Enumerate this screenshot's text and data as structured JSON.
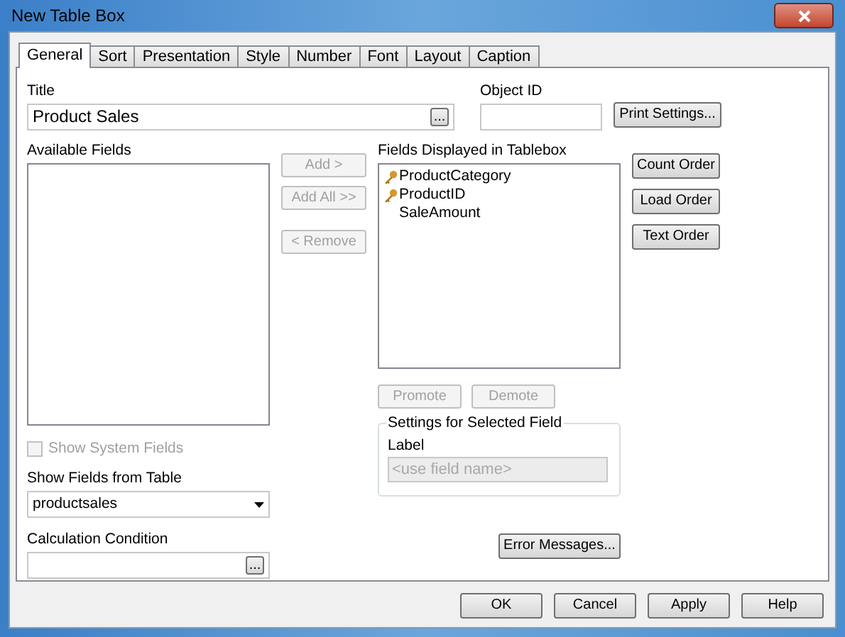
{
  "window": {
    "title": "New Table Box"
  },
  "tabs": [
    {
      "label": "General",
      "selected": true
    },
    {
      "label": "Sort",
      "selected": false
    },
    {
      "label": "Presentation",
      "selected": false
    },
    {
      "label": "Style",
      "selected": false
    },
    {
      "label": "Number",
      "selected": false
    },
    {
      "label": "Font",
      "selected": false
    },
    {
      "label": "Layout",
      "selected": false
    },
    {
      "label": "Caption",
      "selected": false
    }
  ],
  "title": {
    "label": "Title",
    "value": "Product Sales",
    "browse": "..."
  },
  "object_id": {
    "label": "Object ID"
  },
  "print_settings": "Print Settings...",
  "available_fields": {
    "label": "Available Fields"
  },
  "move_buttons": [
    {
      "label": "Add >",
      "disabled": true
    },
    {
      "label": "Add All >>",
      "disabled": true
    },
    {
      "label": "< Remove",
      "disabled": true
    }
  ],
  "displayed_fields": {
    "label": "Fields Displayed in Tablebox",
    "items": [
      {
        "name": "ProductCategory",
        "key": true
      },
      {
        "name": "ProductID",
        "key": true
      },
      {
        "name": "SaleAmount",
        "key": false
      }
    ]
  },
  "order_buttons": [
    "Count Order",
    "Load Order",
    "Text Order"
  ],
  "promote_buttons": [
    {
      "label": "Promote",
      "disabled": true
    },
    {
      "label": "Demote",
      "disabled": true
    }
  ],
  "show_system_fields": {
    "label": "Show System Fields",
    "checked": false,
    "disabled": true
  },
  "show_fields_from_table": {
    "label": "Show Fields from Table",
    "value": "productsales"
  },
  "settings_group": {
    "title": "Settings for Selected Field",
    "label": "Label",
    "placeholder": "<use field name>",
    "disabled": true
  },
  "calculation_condition": {
    "label": "Calculation Condition",
    "browse": "..."
  },
  "error_messages": "Error Messages...",
  "footer_buttons": [
    "OK",
    "Cancel",
    "Apply",
    "Help"
  ]
}
